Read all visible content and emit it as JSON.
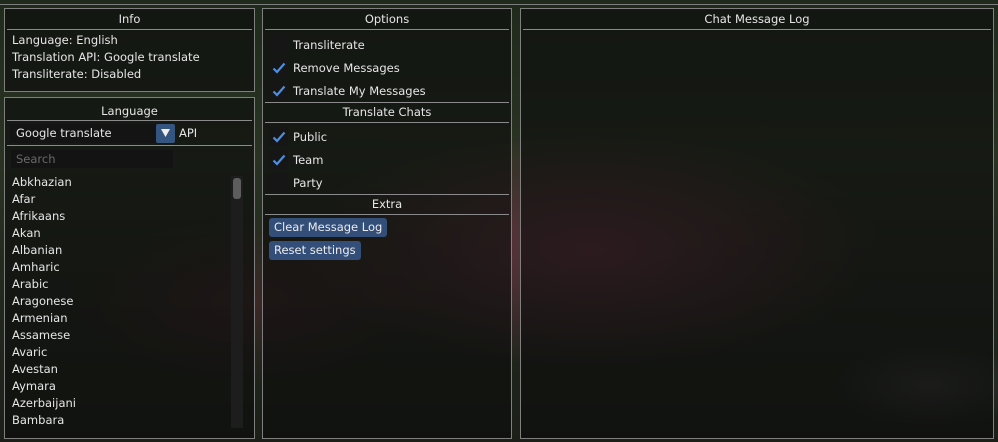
{
  "info": {
    "title": "Info",
    "language": "Language: English",
    "api": "Translation API: Google translate",
    "transliterate": "Transliterate: Disabled"
  },
  "language": {
    "title": "Language",
    "api_selected": "Google translate",
    "api_suffix": "API",
    "search_placeholder": "Search",
    "items": [
      "Abkhazian",
      "Afar",
      "Afrikaans",
      "Akan",
      "Albanian",
      "Amharic",
      "Arabic",
      "Aragonese",
      "Armenian",
      "Assamese",
      "Avaric",
      "Avestan",
      "Aymara",
      "Azerbaijani",
      "Bambara"
    ]
  },
  "options": {
    "title": "Options",
    "transliterate": {
      "label": "Transliterate",
      "checked": false
    },
    "remove_messages": {
      "label": "Remove Messages",
      "checked": true
    },
    "translate_my_messages": {
      "label": "Translate My Messages",
      "checked": true
    },
    "translate_chats_title": "Translate Chats",
    "public": {
      "label": "Public",
      "checked": true
    },
    "team": {
      "label": "Team",
      "checked": true
    },
    "party": {
      "label": "Party",
      "checked": false
    },
    "extra_title": "Extra",
    "clear_log_label": "Clear Message Log",
    "reset_label": "Reset settings"
  },
  "chat_log": {
    "title": "Chat Message Log"
  },
  "colors": {
    "accent": "#324e79",
    "check": "#4d8ee0"
  }
}
